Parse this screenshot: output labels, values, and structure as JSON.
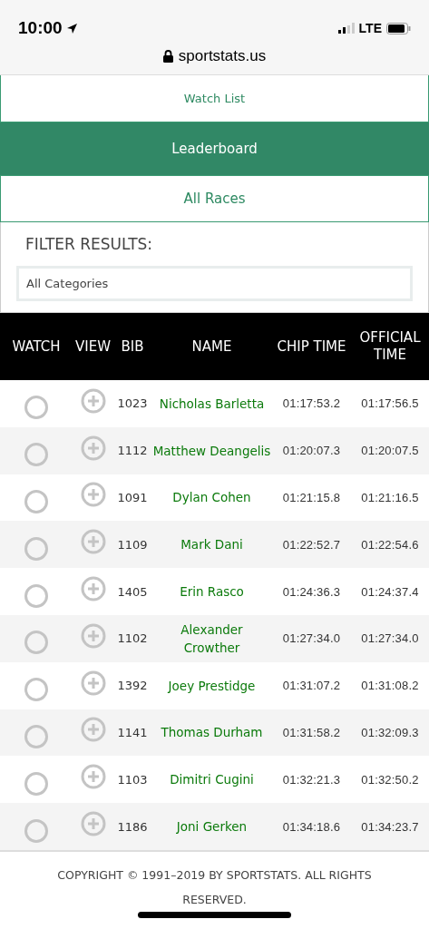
{
  "status_bar": {
    "time": "10:00",
    "network": "LTE"
  },
  "address_bar": {
    "url": "sportstats.us"
  },
  "menu": [
    {
      "label": "Watch List",
      "selected": false
    },
    {
      "label": "Leaderboard",
      "selected": true
    },
    {
      "label": "All Races",
      "selected": false
    }
  ],
  "filter": {
    "title": "FILTER RESULTS:",
    "value": "All Categories"
  },
  "table": {
    "columns": [
      "WATCH",
      "VIEW",
      "BIB",
      "NAME",
      "CHIP TIME",
      "OFFICIAL TIME"
    ],
    "rows": [
      {
        "watched": false,
        "bib": "1023",
        "name": "Nicholas Barletta",
        "chip_time": "01:17:53.2",
        "official_time": "01:17:56.5"
      },
      {
        "watched": false,
        "bib": "1112",
        "name": "Matthew Deangelis",
        "chip_time": "01:20:07.3",
        "official_time": "01:20:07.5"
      },
      {
        "watched": false,
        "bib": "1091",
        "name": "Dylan Cohen",
        "chip_time": "01:21:15.8",
        "official_time": "01:21:16.5"
      },
      {
        "watched": false,
        "bib": "1109",
        "name": "Mark Dani",
        "chip_time": "01:22:52.7",
        "official_time": "01:22:54.6"
      },
      {
        "watched": false,
        "bib": "1405",
        "name": "Erin Rasco",
        "chip_time": "01:24:36.3",
        "official_time": "01:24:37.4"
      },
      {
        "watched": false,
        "bib": "1102",
        "name": "Alexander Crowther",
        "chip_time": "01:27:34.0",
        "official_time": "01:27:34.0"
      },
      {
        "watched": false,
        "bib": "1392",
        "name": "Joey Prestidge",
        "chip_time": "01:31:07.2",
        "official_time": "01:31:08.2"
      },
      {
        "watched": false,
        "bib": "1141",
        "name": "Thomas Durham",
        "chip_time": "01:31:58.2",
        "official_time": "01:32:09.3"
      },
      {
        "watched": false,
        "bib": "1103",
        "name": "Dimitri Cugini",
        "chip_time": "01:32:21.3",
        "official_time": "01:32:50.2"
      },
      {
        "watched": false,
        "bib": "1186",
        "name": "Joni Gerken",
        "chip_time": "01:34:18.6",
        "official_time": "01:34:23.7"
      }
    ]
  },
  "footer": "COPYRIGHT © 1991–2019 BY SPORTSTATS. ALL RIGHTS RESERVED."
}
